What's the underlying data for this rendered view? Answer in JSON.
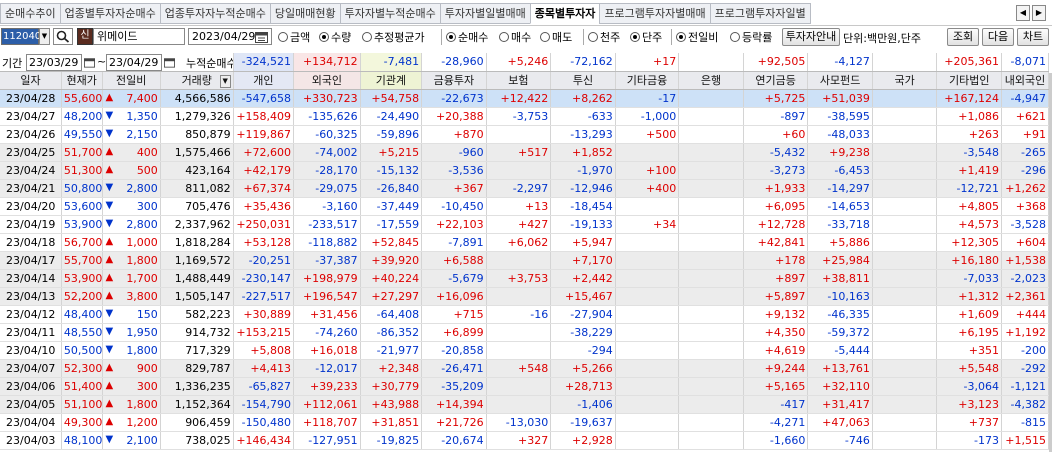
{
  "tabs": [
    "순매수추이",
    "업종별투자자순매수",
    "업종투자자누적순매수",
    "당일매매현황",
    "투자자별누적순매수",
    "투자자별일별매매",
    "종목별투자자",
    "프로그램투자자별매매",
    "프로그램투자자일별"
  ],
  "active_tab": 6,
  "search": {
    "code": "112040",
    "sin": "신",
    "name": "위메이드",
    "date": "2023/04/29",
    "radio_amount": "금액",
    "radio_qty": "수량",
    "radio_avg": "추정평균가",
    "radio_net": "순매수",
    "radio_buy": "매수",
    "radio_sell": "매도",
    "radio_thousand": "천주",
    "radio_unit": "단주",
    "radio_prevday": "전일비",
    "radio_rate": "등락률",
    "btn_guide": "투자자안내",
    "unit_label": "단위:백만원,단주",
    "btn_query": "조회",
    "btn_next": "다음",
    "btn_chart": "차트"
  },
  "period": {
    "label": "기간",
    "from": "23/03/29",
    "to": "23/04/29",
    "cum_label": "누적순매수"
  },
  "totals": [
    "-324,521",
    "+134,712",
    "-7,481",
    "-28,960",
    "+5,246",
    "-72,162",
    "+17",
    "",
    "+92,505",
    "-4,127",
    "",
    "+205,361",
    "-8,071"
  ],
  "headers": [
    "일자",
    "현재가",
    "전일비",
    "거래량",
    "개인",
    "외국인",
    "기관계",
    "금융투자",
    "보험",
    "투신",
    "기타금융",
    "은행",
    "연기금등",
    "사모펀드",
    "국가",
    "기타법인",
    "내외국인"
  ],
  "rows": [
    [
      "23/04/28",
      "55,600",
      "up",
      "7,400",
      "4,566,586",
      "-547,658",
      "+330,723",
      "+54,758",
      "-22,673",
      "+12,422",
      "+8,262",
      "-17",
      "",
      "+5,725",
      "+51,039",
      "",
      "+167,124",
      "-4,947"
    ],
    [
      "23/04/27",
      "48,200",
      "dn",
      "1,350",
      "1,279,326",
      "+158,409",
      "-135,626",
      "-24,490",
      "+20,388",
      "-3,753",
      "-633",
      "-1,000",
      "",
      "-897",
      "-38,595",
      "",
      "+1,086",
      "+621"
    ],
    [
      "23/04/26",
      "49,550",
      "dn",
      "2,150",
      "850,879",
      "+119,867",
      "-60,325",
      "-59,896",
      "+870",
      "",
      "-13,293",
      "+500",
      "",
      "+60",
      "-48,033",
      "",
      "+263",
      "+91"
    ],
    [
      "23/04/25",
      "51,700",
      "up",
      "400",
      "1,575,466",
      "+72,600",
      "-74,002",
      "+5,215",
      "-960",
      "+517",
      "+1,852",
      "",
      "",
      "-5,432",
      "+9,238",
      "",
      "-3,548",
      "-265"
    ],
    [
      "23/04/24",
      "51,300",
      "up",
      "500",
      "423,164",
      "+42,179",
      "-28,170",
      "-15,132",
      "-3,536",
      "",
      "-1,970",
      "+100",
      "",
      "-3,273",
      "-6,453",
      "",
      "+1,419",
      "-296"
    ],
    [
      "23/04/21",
      "50,800",
      "dn",
      "2,800",
      "811,082",
      "+67,374",
      "-29,075",
      "-26,840",
      "+367",
      "-2,297",
      "-12,946",
      "+400",
      "",
      "+1,933",
      "-14,297",
      "",
      "-12,721",
      "+1,262"
    ],
    [
      "23/04/20",
      "53,600",
      "dn",
      "300",
      "705,476",
      "+35,436",
      "-3,160",
      "-37,449",
      "-10,450",
      "+13",
      "-18,454",
      "",
      "",
      "+6,095",
      "-14,653",
      "",
      "+4,805",
      "+368"
    ],
    [
      "23/04/19",
      "53,900",
      "dn",
      "2,800",
      "2,337,962",
      "+250,031",
      "-233,517",
      "-17,559",
      "+22,103",
      "+427",
      "-19,133",
      "+34",
      "",
      "+12,728",
      "-33,718",
      "",
      "+4,573",
      "-3,528"
    ],
    [
      "23/04/18",
      "56,700",
      "up",
      "1,000",
      "1,818,284",
      "+53,128",
      "-118,882",
      "+52,845",
      "-7,891",
      "+6,062",
      "+5,947",
      "",
      "",
      "+42,841",
      "+5,886",
      "",
      "+12,305",
      "+604"
    ],
    [
      "23/04/17",
      "55,700",
      "up",
      "1,800",
      "1,169,572",
      "-20,251",
      "-37,387",
      "+39,920",
      "+6,588",
      "",
      "+7,170",
      "",
      "",
      "+178",
      "+25,984",
      "",
      "+16,180",
      "+1,538"
    ],
    [
      "23/04/14",
      "53,900",
      "up",
      "1,700",
      "1,488,449",
      "-230,147",
      "+198,979",
      "+40,224",
      "-5,679",
      "+3,753",
      "+2,442",
      "",
      "",
      "+897",
      "+38,811",
      "",
      "-7,033",
      "-2,023"
    ],
    [
      "23/04/13",
      "52,200",
      "up",
      "3,800",
      "1,505,147",
      "-227,517",
      "+196,547",
      "+27,297",
      "+16,096",
      "",
      "+15,467",
      "",
      "",
      "+5,897",
      "-10,163",
      "",
      "+1,312",
      "+2,361"
    ],
    [
      "23/04/12",
      "48,400",
      "dn",
      "150",
      "582,223",
      "+30,889",
      "+31,456",
      "-64,408",
      "+715",
      "-16",
      "-27,904",
      "",
      "",
      "+9,132",
      "-46,335",
      "",
      "+1,609",
      "+444"
    ],
    [
      "23/04/11",
      "48,550",
      "dn",
      "1,950",
      "914,732",
      "+153,215",
      "-74,260",
      "-86,352",
      "+6,899",
      "",
      "-38,229",
      "",
      "",
      "+4,350",
      "-59,372",
      "",
      "+6,195",
      "+1,192"
    ],
    [
      "23/04/10",
      "50,500",
      "dn",
      "1,800",
      "717,329",
      "+5,808",
      "+16,018",
      "-21,977",
      "-20,858",
      "",
      "-294",
      "",
      "",
      "+4,619",
      "-5,444",
      "",
      "+351",
      "-200"
    ],
    [
      "23/04/07",
      "52,300",
      "up",
      "900",
      "829,787",
      "+4,413",
      "-12,017",
      "+2,348",
      "-26,471",
      "+548",
      "+5,266",
      "",
      "",
      "+9,244",
      "+13,761",
      "",
      "+5,548",
      "-292"
    ],
    [
      "23/04/06",
      "51,400",
      "up",
      "300",
      "1,336,235",
      "-65,827",
      "+39,233",
      "+30,779",
      "-35,209",
      "",
      "+28,713",
      "",
      "",
      "+5,165",
      "+32,110",
      "",
      "-3,064",
      "-1,121"
    ],
    [
      "23/04/05",
      "51,100",
      "up",
      "1,800",
      "1,152,364",
      "-154,790",
      "+112,061",
      "+43,988",
      "+14,394",
      "",
      "-1,406",
      "",
      "",
      "-417",
      "+31,417",
      "",
      "+3,123",
      "-4,382"
    ],
    [
      "23/04/04",
      "49,300",
      "up",
      "1,200",
      "906,459",
      "-150,480",
      "+118,707",
      "+31,851",
      "+21,726",
      "-13,030",
      "-19,637",
      "",
      "",
      "-4,271",
      "+47,063",
      "",
      "+737",
      "-815"
    ],
    [
      "23/04/03",
      "48,100",
      "dn",
      "2,100",
      "738,025",
      "+146,434",
      "-127,951",
      "-19,825",
      "-20,674",
      "+327",
      "+2,928",
      "",
      "",
      "-1,660",
      "-746",
      "",
      "-173",
      "+1,515"
    ]
  ],
  "colors": {
    "up": "#dd0000",
    "down": "#0033cc",
    "selected_row": "#cde1f7",
    "code_bg": "#2c5ea8"
  }
}
